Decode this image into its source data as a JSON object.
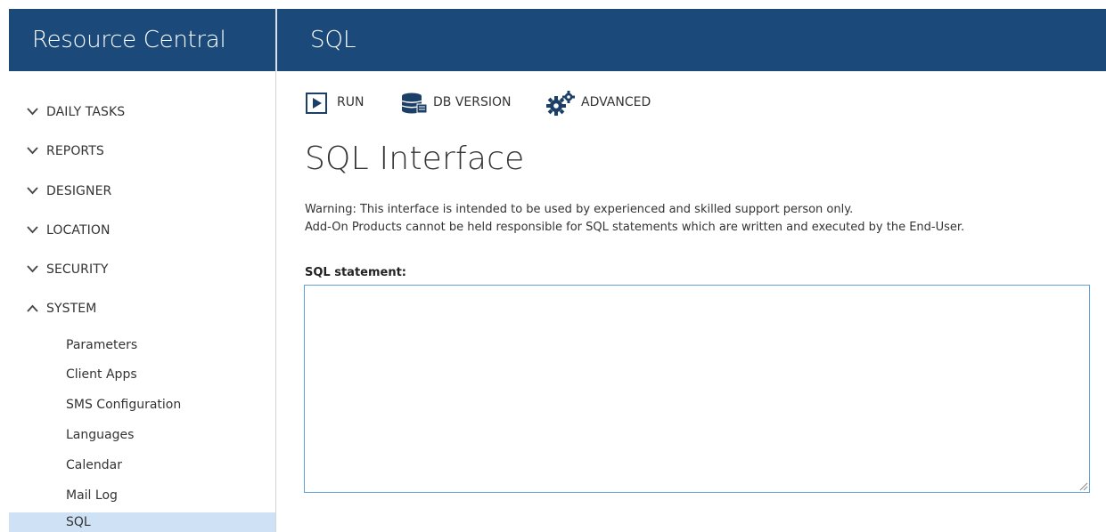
{
  "header": {
    "brand": "Resource Central",
    "page_title": "SQL"
  },
  "sidebar": {
    "sections": [
      {
        "label": "DAILY TASKS",
        "state": "collapsed"
      },
      {
        "label": "REPORTS",
        "state": "collapsed"
      },
      {
        "label": "DESIGNER",
        "state": "collapsed"
      },
      {
        "label": "LOCATION",
        "state": "collapsed"
      },
      {
        "label": "SECURITY",
        "state": "collapsed"
      },
      {
        "label": "SYSTEM",
        "state": "expanded"
      }
    ],
    "system_items": [
      {
        "label": "Parameters"
      },
      {
        "label": "Client Apps"
      },
      {
        "label": "SMS Configuration"
      },
      {
        "label": "Languages"
      },
      {
        "label": "Calendar"
      },
      {
        "label": "Mail Log"
      },
      {
        "label": "SQL",
        "active": true
      }
    ]
  },
  "toolbar": {
    "run": {
      "label": "RUN",
      "icon": "play-icon"
    },
    "db_version": {
      "label": "DB VERSION",
      "icon": "database-icon"
    },
    "advanced": {
      "label": "ADVANCED",
      "icon": "gears-icon"
    }
  },
  "main": {
    "title": "SQL Interface",
    "warning_line1": "Warning: This interface is intended to be used by experienced and skilled support person only.",
    "warning_line2": "Add-On Products cannot be held responsible for SQL statements which are written and executed by the End-User.",
    "sql_label": "SQL statement:",
    "sql_value": ""
  },
  "colors": {
    "header_bg": "#1b4a7a",
    "active_item_bg": "#cfe2f5",
    "input_border": "#5fa2d3"
  }
}
